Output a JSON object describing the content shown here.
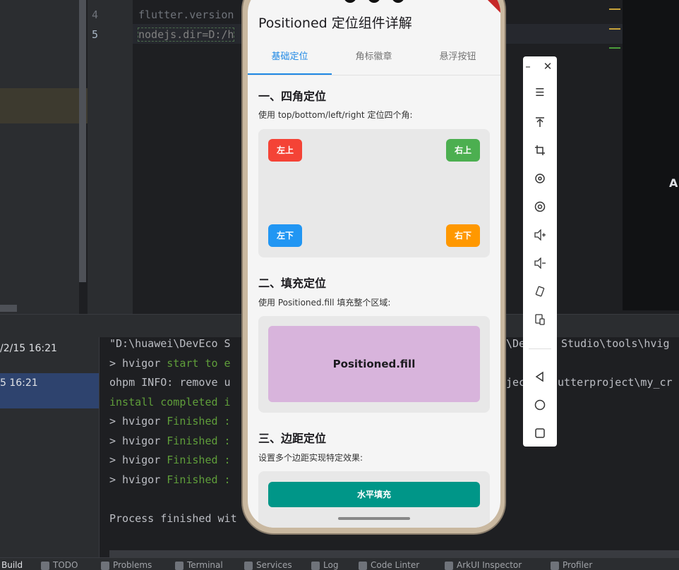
{
  "editor": {
    "lines": [
      {
        "number": "4",
        "code": "flutter.version"
      },
      {
        "number": "5",
        "code": "nodejs.dir=D:/h"
      }
    ],
    "right_panel_letter": "A"
  },
  "tree": {
    "items": [
      "/2/15 16:21",
      "5 16:21"
    ]
  },
  "console": {
    "lines": [
      {
        "text": "\"D:\\huawei\\DevEco S",
        "tail": "\\De",
        "tail2": "Studio\\tools\\hvig"
      },
      {
        "prefix": "> hvigor ",
        "green": "start to e"
      },
      {
        "text": "ohpm INFO: remove u",
        "tail": "jec",
        "tail2": "lutterproject\\my_cr"
      },
      {
        "green": "install completed i"
      },
      {
        "prefix": "> hvigor ",
        "green": "Finished :"
      },
      {
        "prefix": "> hvigor ",
        "green": "Finished :"
      },
      {
        "prefix": "> hvigor ",
        "green": "Finished :"
      },
      {
        "prefix": "> hvigor ",
        "green": "Finished :"
      },
      {
        "text": "Process finished wit"
      }
    ]
  },
  "bottom_tabs": [
    "Build",
    "TODO",
    "Problems",
    "Terminal",
    "Services",
    "Log",
    "Code Linter",
    "ArkUI Inspector",
    "Profiler"
  ],
  "app": {
    "title": "Positioned 定位组件详解",
    "tabs": [
      "基础定位",
      "角标徽章",
      "悬浮按钮"
    ],
    "active_tab": 0,
    "section1": {
      "title": "一、四角定位",
      "desc": "使用 top/bottom/left/right 定位四个角:",
      "chips": [
        {
          "label": "左上",
          "color": "#f44336"
        },
        {
          "label": "右上",
          "color": "#4caf50"
        },
        {
          "label": "左下",
          "color": "#2196f3"
        },
        {
          "label": "右下",
          "color": "#ff9800"
        }
      ]
    },
    "section2": {
      "title": "二、填充定位",
      "desc": "使用 Positioned.fill 填充整个区域:",
      "fill_label": "Positioned.fill"
    },
    "section3": {
      "title": "三、边距定位",
      "desc": "设置多个边距实现特定效果:",
      "bar_label": "水平填充"
    }
  },
  "emulator_toolbar": {
    "icons": [
      "minimize-icon",
      "close-icon",
      "menu-icon",
      "top-icon",
      "crop-icon",
      "rotate-icon",
      "location-icon",
      "volume-up-icon",
      "volume-down-icon",
      "rotate-device-icon",
      "multi-device-icon",
      "back-icon",
      "home-icon",
      "recent-icon"
    ]
  }
}
